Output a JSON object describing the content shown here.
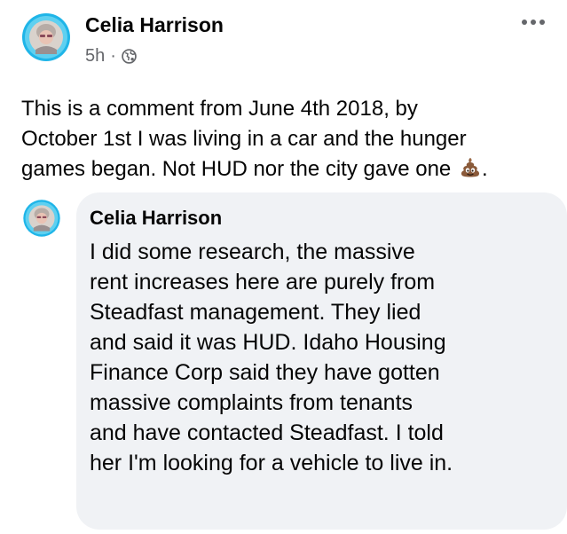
{
  "post": {
    "author": "Celia Harrison",
    "timestamp": "5h",
    "separator": "·",
    "audience_icon": "globe-icon",
    "more_icon": "more-options-icon",
    "text_lines": [
      "This is a comment from June 4th 2018, by",
      "October 1st I was living in a car and the hunger",
      "games began. Not HUD nor the city gave one"
    ],
    "text_end": ".",
    "emoji": "pile-of-poo-emoji"
  },
  "comment": {
    "author": "Celia Harrison",
    "text_lines": [
      "I did some research, the massive",
      "rent increases here are purely from",
      "Steadfast management. They lied",
      "and said it was HUD. Idaho Housing",
      "Finance Corp said they have gotten",
      "massive complaints from tenants",
      "and have contacted Steadfast. I told",
      "her I'm looking for a vehicle to live in."
    ]
  },
  "colors": {
    "text_primary": "#050505",
    "text_secondary": "#65676b",
    "comment_background": "#f0f2f5",
    "avatar_ring": "#1fb5e8"
  }
}
